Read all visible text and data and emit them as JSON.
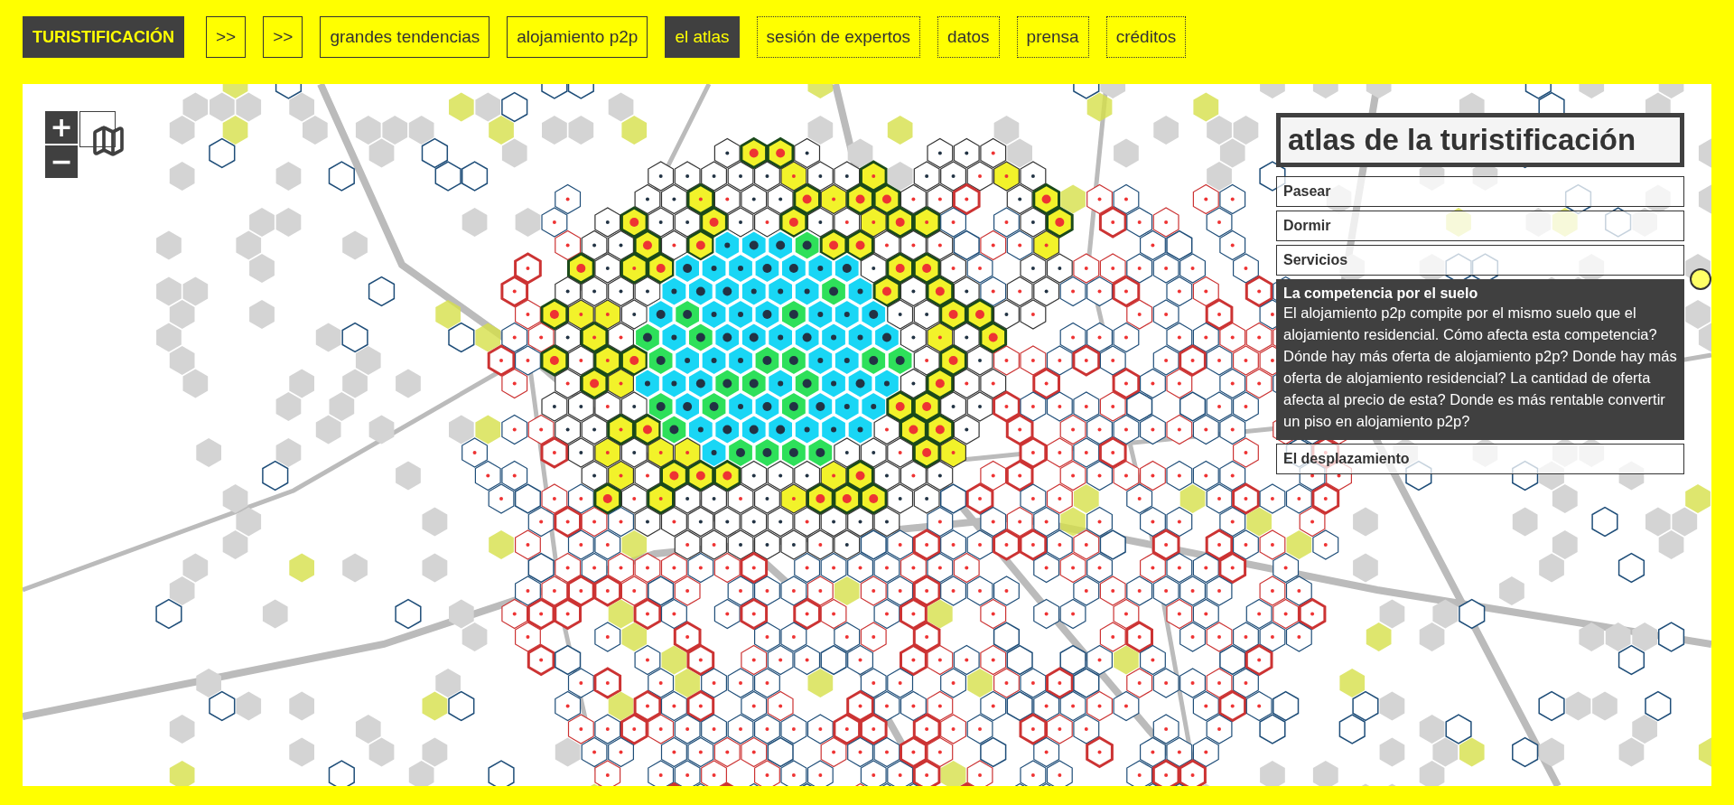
{
  "nav": [
    {
      "label": "TURISTIFICACIÓN",
      "kind": "brand",
      "selected": true,
      "dotted": false
    },
    {
      "label": ">>",
      "kind": "link",
      "selected": false,
      "dotted": false
    },
    {
      "label": ">>",
      "kind": "link",
      "selected": false,
      "dotted": false
    },
    {
      "label": "grandes tendencias",
      "kind": "link",
      "selected": false,
      "dotted": false
    },
    {
      "label": "alojamiento p2p",
      "kind": "link",
      "selected": false,
      "dotted": false
    },
    {
      "label": "el atlas",
      "kind": "link",
      "selected": true,
      "dotted": false
    },
    {
      "label": "sesión de expertos",
      "kind": "link",
      "selected": false,
      "dotted": true
    },
    {
      "label": "datos",
      "kind": "link",
      "selected": false,
      "dotted": true
    },
    {
      "label": "prensa",
      "kind": "link",
      "selected": false,
      "dotted": true
    },
    {
      "label": "créditos",
      "kind": "link",
      "selected": false,
      "dotted": true
    }
  ],
  "map_controls": {
    "zoom_in": "+",
    "zoom_out": "−"
  },
  "panel": {
    "title": "atlas de la turistificación",
    "sections": [
      {
        "title": "Pasear",
        "expanded": false
      },
      {
        "title": "Dormir",
        "expanded": false
      },
      {
        "title": "Servicios",
        "expanded": false
      },
      {
        "title": "La competencia por el suelo",
        "expanded": true,
        "text": "El alojamiento p2p compite por el mismo suelo que el alojamiento residencial. Cómo afecta esta competencia? Dónde hay más oferta de alojamiento p2p? Donde hay más oferta de alojamiento residencial? La cantidad de oferta afecta al precio de esta? Donde es más rentable convertir un piso en alojamiento p2p?"
      },
      {
        "title": "El desplazamiento",
        "expanded": false
      }
    ]
  }
}
